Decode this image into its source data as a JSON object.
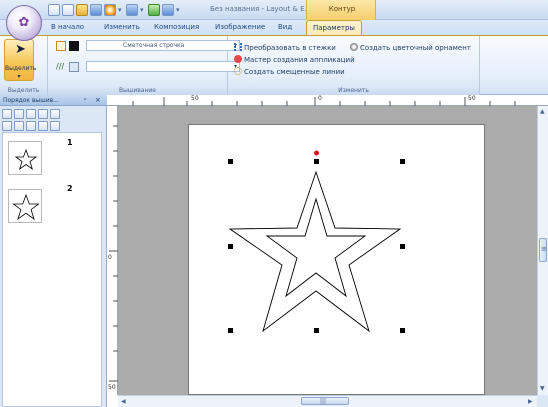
{
  "titlebar": {
    "title": "Без названия - Layout & E...",
    "context_tab": "Контур"
  },
  "tabs": [
    {
      "label": "В начало",
      "active": false
    },
    {
      "label": "Изменить",
      "active": false
    },
    {
      "label": "Композиция",
      "active": false
    },
    {
      "label": "Изображение",
      "active": false
    },
    {
      "label": "Вид",
      "active": false
    },
    {
      "label": "Параметры",
      "active": true
    }
  ],
  "ribbon": {
    "select": {
      "label": "Выделить",
      "group_label": "Выделить"
    },
    "embroidery": {
      "group_label": "Вышивание",
      "line_type": "Сметочная строчка"
    },
    "modify": {
      "group_label": "Изменить",
      "convert_to_stitches": "Преобразовать в стежки",
      "applique_wizard": "Мастер создания аппликаций",
      "offset_lines": "Создать смещенные линии",
      "flower_ornament": "Создать цветочный орнамент"
    }
  },
  "panel": {
    "title": "Порядок вышив...",
    "pin": "ᵘ",
    "close": "×",
    "items": [
      {
        "number": "1",
        "icon": "star-outline-icon"
      },
      {
        "number": "2",
        "icon": "star-outline-icon"
      }
    ]
  },
  "rulers": {
    "top_labels": [
      "50",
      "0",
      "50"
    ],
    "left_labels": [
      "0",
      "50"
    ]
  },
  "scrollbar": {
    "grip": "≡",
    "h_grip": "|||"
  },
  "colors": {
    "accent": "#f7c75a",
    "ribbon_blue": "#dce7f5",
    "canvas_gray": "#ababab",
    "handle_red": "#e0121b"
  }
}
